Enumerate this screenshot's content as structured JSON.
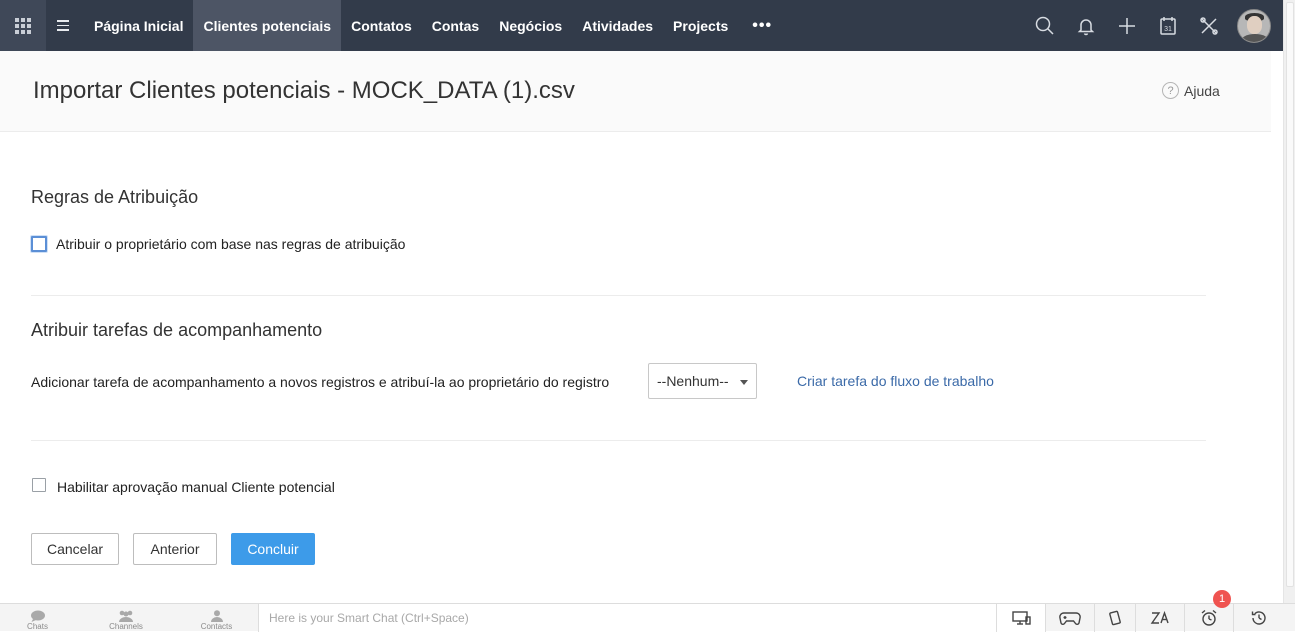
{
  "nav": {
    "items": [
      {
        "label": "Página Inicial",
        "active": false
      },
      {
        "label": "Clientes potenciais",
        "active": true
      },
      {
        "label": "Contatos",
        "active": false
      },
      {
        "label": "Contas",
        "active": false
      },
      {
        "label": "Negócios",
        "active": false
      },
      {
        "label": "Atividades",
        "active": false
      },
      {
        "label": "Projects",
        "active": false
      }
    ],
    "more_label": "•••",
    "calendar_day": "31"
  },
  "header": {
    "title": "Importar Clientes potenciais - MOCK_DATA (1).csv",
    "help_icon_glyph": "?",
    "help_label": "Ajuda"
  },
  "assignment": {
    "section_title": "Regras de Atribuição",
    "checkbox_label": "Atribuir o proprietário com base nas regras de atribuição",
    "checked": false
  },
  "followup": {
    "section_title": "Atribuir tarefas de acompanhamento",
    "row_label": "Adicionar tarefa de acompanhamento a novos registros e atribuí-la ao proprietário do registro",
    "select_value": "--Nenhum--",
    "link_label": "Criar tarefa do fluxo de trabalho"
  },
  "approval": {
    "checkbox_label": "Habilitar aprovação manual Cliente potencial",
    "checked": false
  },
  "buttons": {
    "cancel": "Cancelar",
    "previous": "Anterior",
    "finish": "Concluir"
  },
  "bottombar": {
    "items": [
      {
        "label": "Chats",
        "icon": "chat-icon"
      },
      {
        "label": "Channels",
        "icon": "channels-icon"
      },
      {
        "label": "Contacts",
        "icon": "contacts-icon"
      }
    ],
    "smartchat_placeholder": "Here is your Smart Chat (Ctrl+Space)",
    "notification_count": "1"
  },
  "colors": {
    "topbar": "#323b4a",
    "active_tab": "#4d5565",
    "primary_button": "#3d9be9",
    "link": "#3b6aa8",
    "badge": "#ef5350"
  }
}
